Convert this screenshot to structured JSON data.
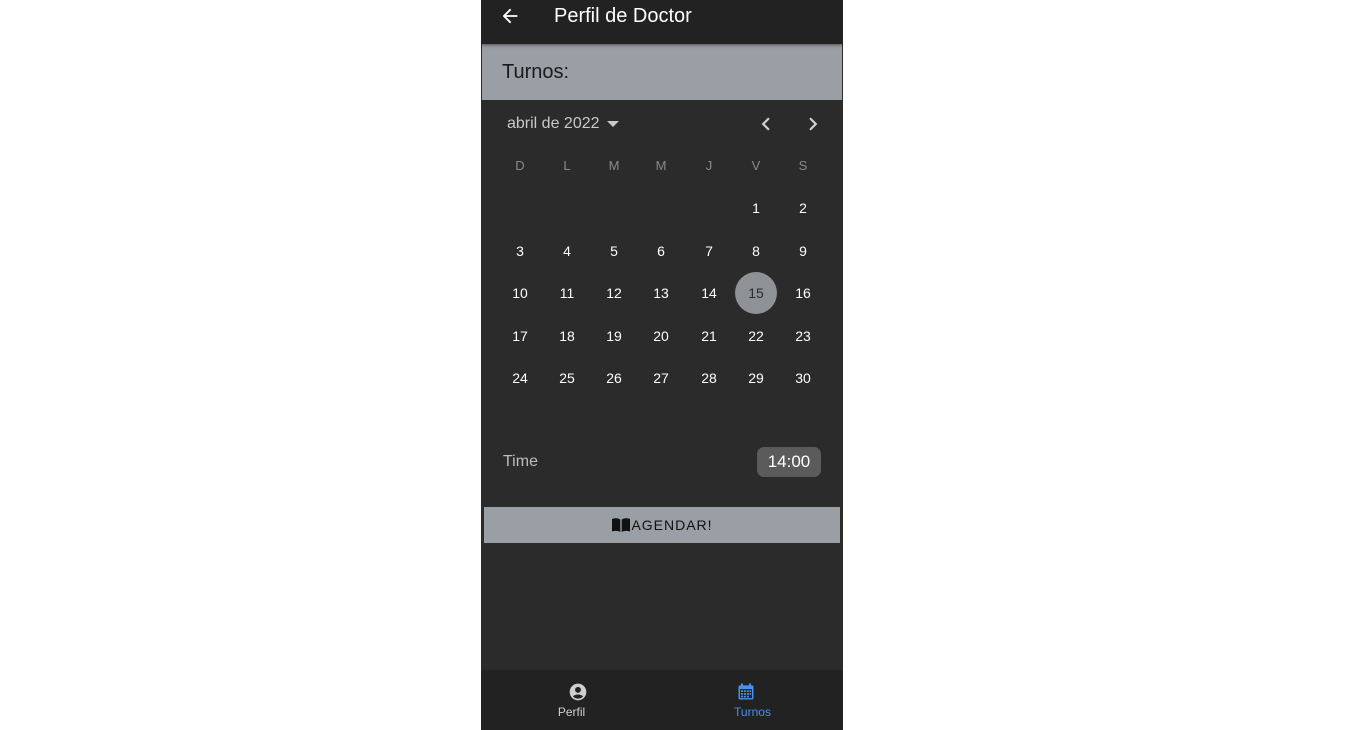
{
  "appbar": {
    "title": "Perfil de Doctor"
  },
  "section": {
    "title": "Turnos:"
  },
  "calendar": {
    "month_label": "abril de 2022",
    "weekdays": [
      "D",
      "L",
      "M",
      "M",
      "J",
      "V",
      "S"
    ],
    "first_weekday_index": 5,
    "days_in_month": 30,
    "selected_day": 15
  },
  "time": {
    "label": "Time",
    "value": "14:00"
  },
  "action": {
    "label": "AGENDAR!"
  },
  "bottom_nav": {
    "items": [
      {
        "label": "Perfil",
        "icon": "account-circle-icon",
        "active": false
      },
      {
        "label": "Turnos",
        "icon": "calendar-icon",
        "active": true
      }
    ]
  },
  "colors": {
    "accent": "#4a8ff0",
    "header_bg": "#9a9ea5",
    "surface": "#2b2b2b",
    "bar": "#222222"
  }
}
